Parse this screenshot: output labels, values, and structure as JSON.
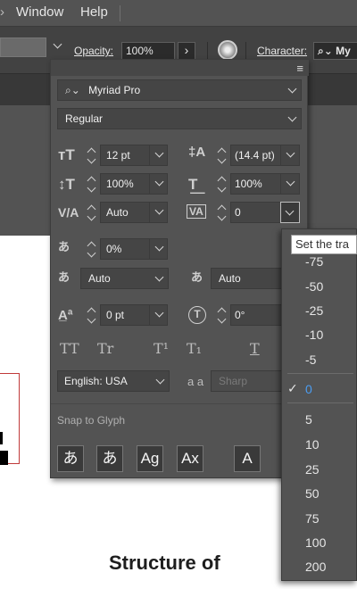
{
  "menubar": {
    "items": [
      "Window",
      "Help"
    ]
  },
  "control_bar": {
    "opacity_label": "Opacity:",
    "opacity_value": "100%",
    "character_label": "Character:",
    "character_font": "My"
  },
  "character_panel": {
    "font_family": "Myriad Pro",
    "font_style": "Regular",
    "font_size": "12 pt",
    "leading": "(14.4 pt)",
    "vertical_scale": "100%",
    "horizontal_scale": "100%",
    "kerning": "Auto",
    "tracking": "0",
    "tsume": "0%",
    "aki_left": "Auto",
    "aki_right": "Auto",
    "baseline_shift": "0 pt",
    "rotation": "0°",
    "language": "English: USA",
    "antialias": "Sharp",
    "antialias_icon": "a a",
    "snap_to_glyph": "Snap to Glyph",
    "text_buttons": [
      "TT",
      "Tr",
      "T¹",
      "T₁",
      "T"
    ],
    "snap_buttons": [
      "あ",
      "あ",
      "Ag",
      "Ax",
      "A"
    ]
  },
  "tracking_dropdown": {
    "tooltip": "Set the tra",
    "options_top": [
      "-75",
      "-50",
      "-25",
      "-10",
      "-5"
    ],
    "selected": "0",
    "options_bottom": [
      "5",
      "10",
      "25",
      "50",
      "75",
      "100",
      "200"
    ]
  },
  "document": {
    "heading_text": "Structure of"
  },
  "colors": {
    "panel_bg": "#535353",
    "field_bg": "#454545",
    "selected_item": "#4b9cf0"
  }
}
